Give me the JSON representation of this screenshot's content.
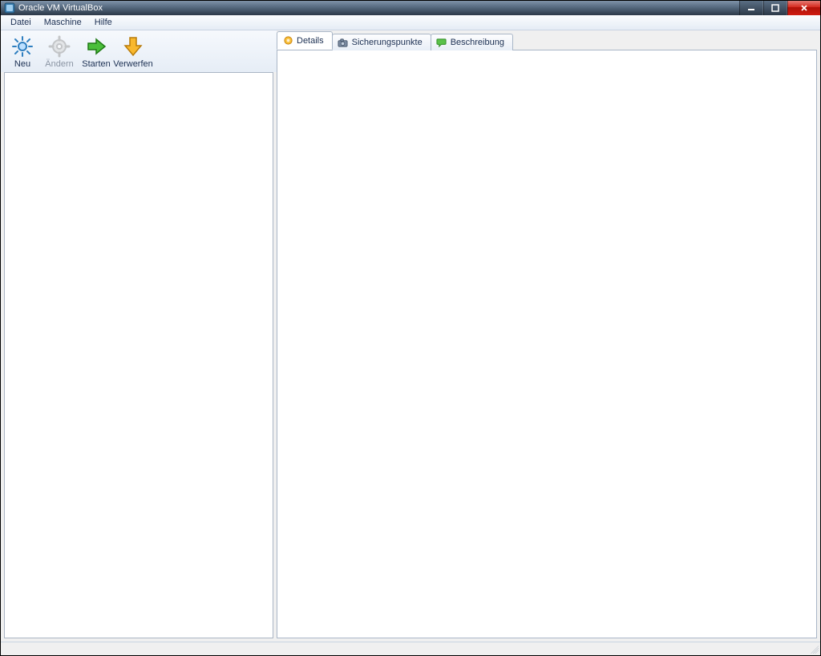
{
  "window": {
    "title": "Oracle VM VirtualBox"
  },
  "menubar": {
    "items": [
      "Datei",
      "Maschine",
      "Hilfe"
    ]
  },
  "toolbar": {
    "buttons": [
      {
        "id": "new",
        "label": "Neu",
        "enabled": true
      },
      {
        "id": "settings",
        "label": "Ändern",
        "enabled": false
      },
      {
        "id": "start",
        "label": "Starten",
        "enabled": true
      },
      {
        "id": "discard",
        "label": "Verwerfen",
        "enabled": true
      }
    ]
  },
  "tabs": {
    "items": [
      {
        "id": "details",
        "label": "Details",
        "active": true
      },
      {
        "id": "snapshots",
        "label": "Sicherungspunkte",
        "active": false
      },
      {
        "id": "description",
        "label": "Beschreibung",
        "active": false
      }
    ]
  }
}
